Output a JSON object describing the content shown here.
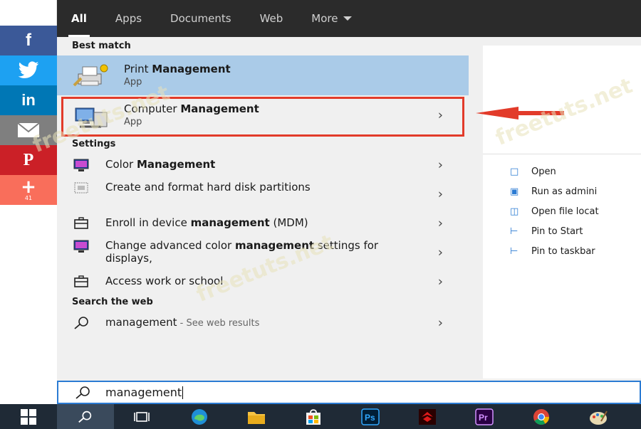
{
  "social": {
    "facebook": "f",
    "twitter": "twitter-bird",
    "linkedin": "in",
    "email": "envelope",
    "pinterest": "P",
    "plus": "+",
    "share_count": "41"
  },
  "nav": {
    "tabs": [
      "All",
      "Apps",
      "Documents",
      "Web",
      "More"
    ],
    "active": "All"
  },
  "results": {
    "best_match_header": "Best match",
    "best": [
      {
        "title_pre": "Print ",
        "title_bold": "Management",
        "sub": "App"
      },
      {
        "title_pre": "Computer ",
        "title_bold": "Management",
        "sub": "App"
      }
    ],
    "settings_header": "Settings",
    "settings": [
      {
        "pre": "Color ",
        "bold": "Management",
        "post": ""
      },
      {
        "pre": "Create and format hard disk partitions",
        "bold": "",
        "post": ""
      },
      {
        "pre": "Enroll in device ",
        "bold": "management",
        "post": " (MDM)"
      },
      {
        "pre": "Change advanced color ",
        "bold": "management",
        "post": " settings for displays,"
      },
      {
        "pre": "Access work or school",
        "bold": "",
        "post": ""
      }
    ],
    "web_header": "Search the web",
    "web": {
      "term": "management",
      "suffix": " - See web results"
    }
  },
  "rightpane": {
    "actions": [
      "Open",
      "Run as admini",
      "Open file locat",
      "Pin to Start",
      "Pin to taskbar"
    ]
  },
  "search": {
    "value": "management"
  },
  "watermark": "freetuts.net",
  "colors": {
    "accent": "#2b7bd3",
    "highlight": "#e23b2a",
    "selected": "#aacbe8"
  }
}
